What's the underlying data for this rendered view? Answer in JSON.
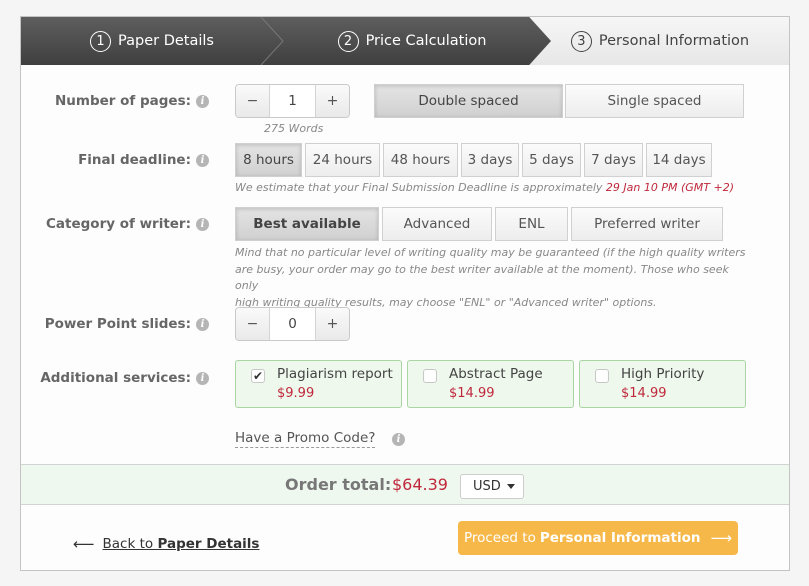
{
  "steps": [
    {
      "number": "1",
      "label": "Paper Details",
      "state": "completed"
    },
    {
      "number": "2",
      "label": "Price Calculation",
      "state": "active"
    },
    {
      "number": "3",
      "label": "Personal Information",
      "state": "upcoming"
    }
  ],
  "pages": {
    "label": "Number of pages:",
    "value": "1",
    "minus": "−",
    "plus": "+",
    "words": "275 Words",
    "spacing_options": [
      "Double spaced",
      "Single spaced"
    ],
    "spacing_selected": "Double spaced"
  },
  "deadline": {
    "label": "Final deadline:",
    "options": [
      "8 hours",
      "24 hours",
      "48 hours",
      "3 days",
      "5 days",
      "7 days",
      "14 days"
    ],
    "selected": "8 hours",
    "estimate_text": "We estimate that your Final Submission Deadline is approximately",
    "estimate_date": "29 Jan 10 PM (GMT +2)"
  },
  "writer": {
    "label": "Category of writer:",
    "options": [
      "Best available",
      "Advanced",
      "ENL",
      "Preferred writer"
    ],
    "selected": "Best available",
    "note_lines": [
      "Mind that no particular level of writing quality may be guaranteed (if the high quality writers",
      "are busy, your order may go to the best writer available at the moment). Those who seek only",
      "high writing quality results, may choose \"ENL\" or \"Advanced writer\" options."
    ]
  },
  "slides": {
    "label": "Power Point slides:",
    "value": "0",
    "minus": "−",
    "plus": "+"
  },
  "services": {
    "label": "Additional services:",
    "items": [
      {
        "name": "Plagiarism report",
        "price": "$9.99",
        "checked": true,
        "check_glyph": "✔"
      },
      {
        "name": "Abstract Page",
        "price": "$14.99",
        "checked": false,
        "check_glyph": ""
      },
      {
        "name": "High Priority",
        "price": "$14.99",
        "checked": false,
        "check_glyph": ""
      }
    ]
  },
  "promo": {
    "label": "Have a Promo Code?"
  },
  "total": {
    "label": "Order total:",
    "value": "$64.39",
    "currency": "USD"
  },
  "footer": {
    "back_arrow": "⟵",
    "back_prefix": "Back to ",
    "back_target": "Paper Details",
    "proceed_prefix": "Proceed to",
    "proceed_target": "Personal Information",
    "proceed_arrow": "⟶"
  },
  "icons": {
    "info": "i"
  },
  "colors": {
    "accent_price": "#c0283c",
    "proceed_button": "#f7b84a",
    "service_bg": "#eef8ec",
    "service_border": "#a8d5a2",
    "step_dark": "#4a4a4a"
  }
}
